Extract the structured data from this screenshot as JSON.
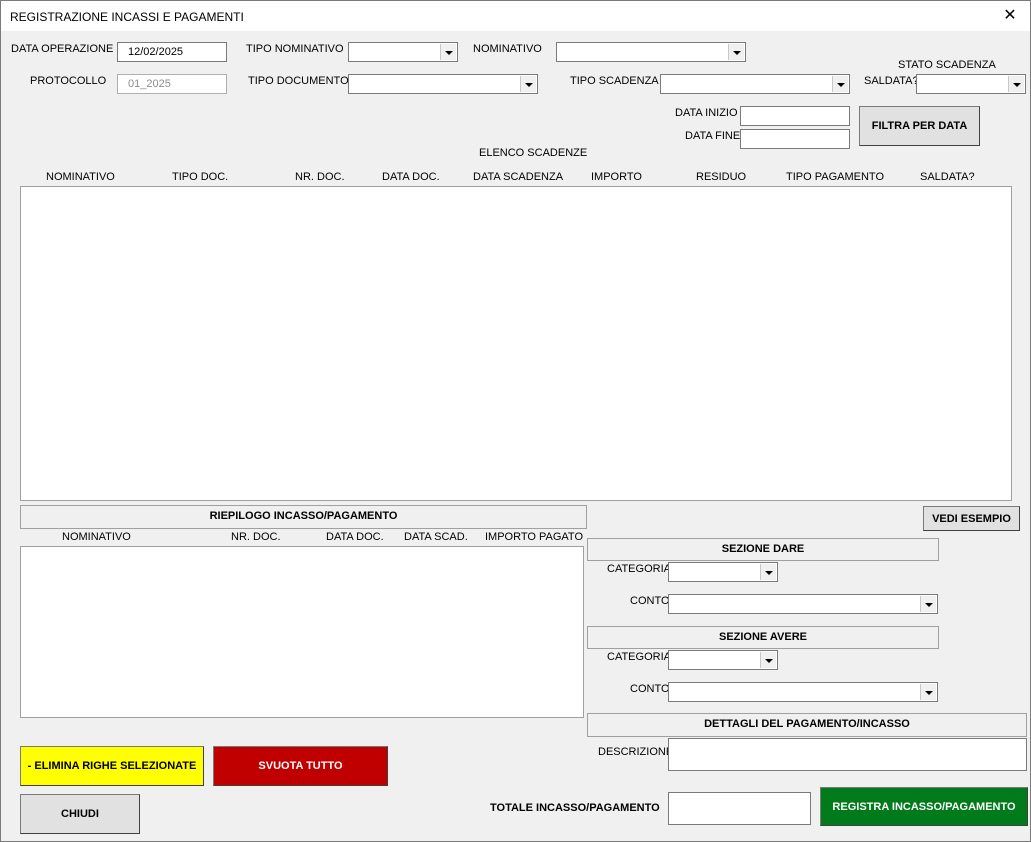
{
  "window": {
    "title": "REGISTRAZIONE INCASSI E PAGAMENTI",
    "close_glyph": "✕"
  },
  "top": {
    "data_operazione_label": "DATA OPERAZIONE",
    "data_operazione_value": "12/02/2025",
    "tipo_nominativo_label": "TIPO NOMINATIVO",
    "nominativo_label": "NOMINATIVO",
    "protocollo_label": "PROTOCOLLO",
    "protocollo_value": "01_2025",
    "tipo_documento_label": "TIPO DOCUMENTO",
    "tipo_scadenza_label": "TIPO SCADENZA",
    "stato_scadenza_label": "STATO SCADENZA",
    "saldata_label": "SALDATA?",
    "data_inizio_label": "DATA INIZIO",
    "data_fine_label": "DATA FINE",
    "filtra_button": "FILTRA PER DATA"
  },
  "scadenze": {
    "title": "ELENCO SCADENZE",
    "columns": [
      "NOMINATIVO",
      "TIPO DOC.",
      "NR. DOC.",
      "DATA DOC.",
      "DATA SCADENZA",
      "IMPORTO",
      "RESIDUO",
      "TIPO PAGAMENTO",
      "SALDATA?"
    ]
  },
  "riepilogo": {
    "title": "RIEPILOGO INCASSO/PAGAMENTO",
    "columns": [
      "NOMINATIVO",
      "NR. DOC.",
      "DATA DOC.",
      "DATA SCAD.",
      "IMPORTO PAGATO"
    ]
  },
  "vedi_esempio_button": "VEDI ESEMPIO",
  "dare": {
    "title": "SEZIONE DARE",
    "categoria_label": "CATEGORIA",
    "conto_label": "CONTO"
  },
  "avere": {
    "title": "SEZIONE AVERE",
    "categoria_label": "CATEGORIA",
    "conto_label": "CONTO"
  },
  "dettagli": {
    "title": "DETTAGLI DEL PAGAMENTO/INCASSO",
    "descrizione_label": "DESCRIZIONE"
  },
  "buttons": {
    "elimina": "- ELIMINA RIGHE SELEZIONATE",
    "svuota": "SVUOTA TUTTO",
    "chiudi": "CHIUDI",
    "registra": "REGISTRA INCASSO/PAGAMENTO"
  },
  "totale_label": "TOTALE INCASSO/PAGAMENTO",
  "colors": {
    "elimina_bg": "#ffff00",
    "svuota_bg": "#c00000",
    "registra_bg": "#007a1a"
  }
}
